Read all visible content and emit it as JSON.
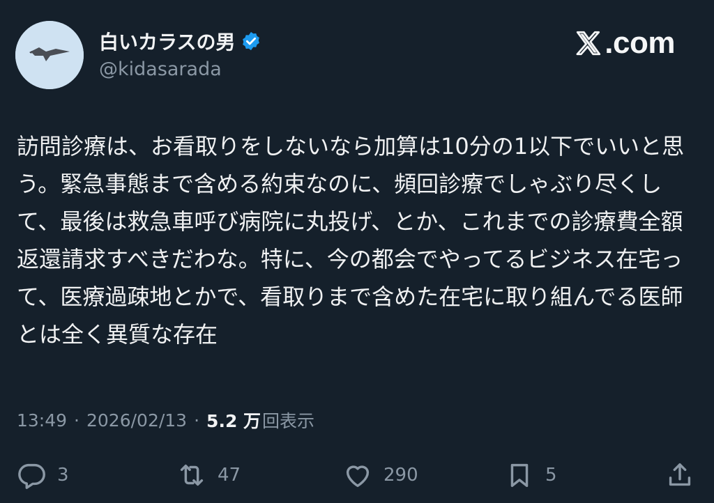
{
  "profile": {
    "display_name": "白いカラスの男",
    "handle": "@kidasarada",
    "verified_icon": "verified-badge-icon",
    "avatar": "crow-in-flight-avatar"
  },
  "brand": {
    "label": ".com",
    "icon": "x-logo-icon"
  },
  "tweet": {
    "text": "訪問診療は、お看取りをしないなら加算は10分の1以下でいいと思う。緊急事態まで含める約束なのに、頻回診療でしゃぶり尽くして、最後は救急車呼び病院に丸投げ、とか、これまでの診療費全額返還請求すべきだわな。特に、今の都会でやってるビジネス在宅って、医療過疎地とかで、看取りまで含めた在宅に取り組んでる医師とは全く異質な存在"
  },
  "meta": {
    "time": "13:49",
    "separator": "·",
    "date": "2026/02/13",
    "views_count": "5.2 万",
    "views_label": "回表示"
  },
  "actions": {
    "reply_count": "3",
    "repost_count": "47",
    "like_count": "290",
    "bookmark_count": "5"
  },
  "colors": {
    "background": "#15202b",
    "text_primary": "#e7e9ea",
    "text_secondary": "#8b98a5",
    "verified": "#1d9bf0"
  }
}
